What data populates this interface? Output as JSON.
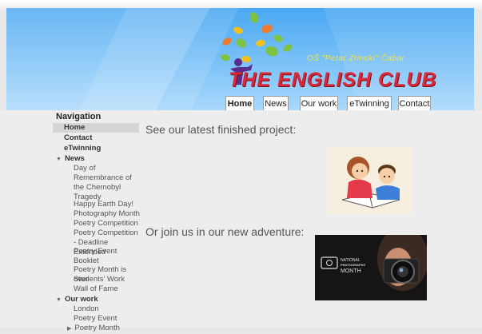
{
  "header": {
    "school_name": "OŠ \"Petar Zrinski\" Čabar",
    "club_title": "THE ENGLISH CLUB"
  },
  "tabs": [
    {
      "label": "Home",
      "active": true
    },
    {
      "label": "News",
      "active": false
    },
    {
      "label": "Our work",
      "active": false
    },
    {
      "label": "eTwinning",
      "active": false
    },
    {
      "label": "Contact",
      "active": false
    }
  ],
  "navigation": {
    "heading": "Navigation",
    "top_items": [
      "Home",
      "Contact",
      "eTwinning"
    ],
    "news": {
      "label": "News",
      "items": [
        "Day of Remembrance of the Chernobyl Tragedy",
        "Happy Earth Day!",
        "Photography Month",
        "Poetry Competition",
        "Poetry Competition - Deadline Extended",
        "Poetry Event Booklet",
        "Poetry Month is over",
        "Students' Work",
        "Wall of Fame"
      ]
    },
    "our_work": {
      "label": "Our work",
      "items": [
        "London",
        "Poetry Event",
        "Poetry Month"
      ]
    }
  },
  "main": {
    "heading_project": "See our latest finished project:",
    "heading_adventure": "Or join us in our new adventure:",
    "photo_overlay_line1": "NATIONAL",
    "photo_overlay_line2": "PHOTOGRAPHY",
    "photo_overlay_line3": "MONTH"
  },
  "colors": {
    "banner_blue": "#4aa8f2",
    "club_red": "#d92a3a",
    "school_yellow": "#f0e24a"
  }
}
